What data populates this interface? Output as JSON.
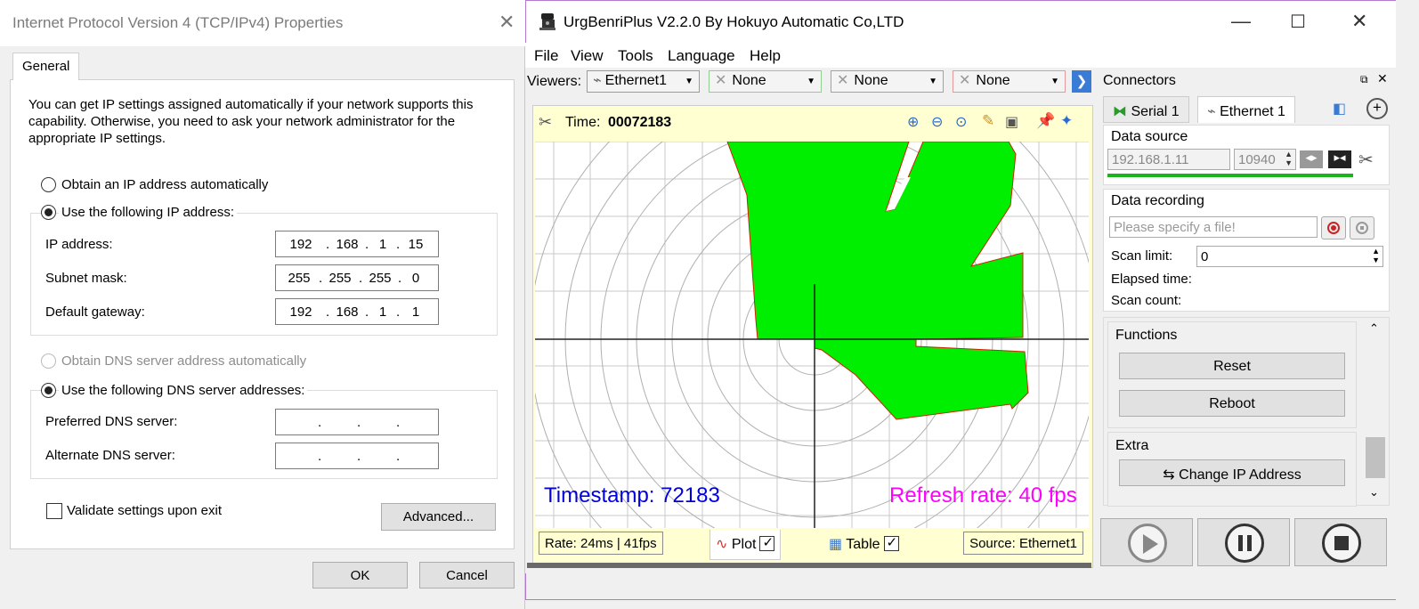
{
  "dialog": {
    "title": "Internet Protocol Version 4 (TCP/IPv4) Properties",
    "tab": "General",
    "intro": "You can get IP settings assigned automatically if your network supports this capability. Otherwise, you need to ask your network administrator for the appropriate IP settings.",
    "ip_auto_label": "Obtain an IP address automatically",
    "ip_manual_label": "Use the following IP address:",
    "ip_address_label": "IP address:",
    "ip_address": [
      "192",
      "168",
      "1",
      "15"
    ],
    "subnet_label": "Subnet mask:",
    "subnet": [
      "255",
      "255",
      "255",
      "0"
    ],
    "gateway_label": "Default gateway:",
    "gateway": [
      "192",
      "168",
      "1",
      "1"
    ],
    "dns_auto_label": "Obtain DNS server address automatically",
    "dns_manual_label": "Use the following DNS server addresses:",
    "preferred_dns_label": "Preferred DNS server:",
    "alternate_dns_label": "Alternate DNS server:",
    "validate_label": "Validate settings upon exit",
    "advanced_label": "Advanced...",
    "ok_label": "OK",
    "cancel_label": "Cancel"
  },
  "app": {
    "title": "UrgBenriPlus V2.2.0 By Hokuyo Automatic Co,LTD",
    "menu": [
      "File",
      "View",
      "Tools",
      "Language",
      "Help"
    ],
    "viewers_label": "Viewers:",
    "viewers": [
      "Ethernet1",
      "None",
      "None",
      "None"
    ],
    "plot": {
      "time_label": "Time:",
      "time_value": "00072183",
      "timestamp": "Timestamp: 72183",
      "refresh": "Refresh rate: 40 fps",
      "rate": "Rate: 24ms | 41fps",
      "tab_plot": "Plot",
      "tab_table": "Table",
      "source": "Source: Ethernet1"
    },
    "connectors": {
      "title": "Connectors",
      "tabs": [
        "Serial 1",
        "Ethernet 1"
      ],
      "data_source_label": "Data source",
      "ip": "192.168.1.11",
      "port": "10940",
      "data_recording_label": "Data recording",
      "file_placeholder": "Please specify a file!",
      "scan_limit_label": "Scan limit:",
      "scan_limit": "0",
      "elapsed_label": "Elapsed time:",
      "scan_count_label": "Scan count:",
      "functions_label": "Functions",
      "reset_label": "Reset",
      "reboot_label": "Reboot",
      "extra_label": "Extra",
      "change_ip_label": "Change IP Address"
    },
    "colors": {
      "scan_fill": "#00ee00",
      "timestamp": "#0000dd",
      "refresh": "#ff00ff",
      "progress": "#1db31d"
    }
  }
}
